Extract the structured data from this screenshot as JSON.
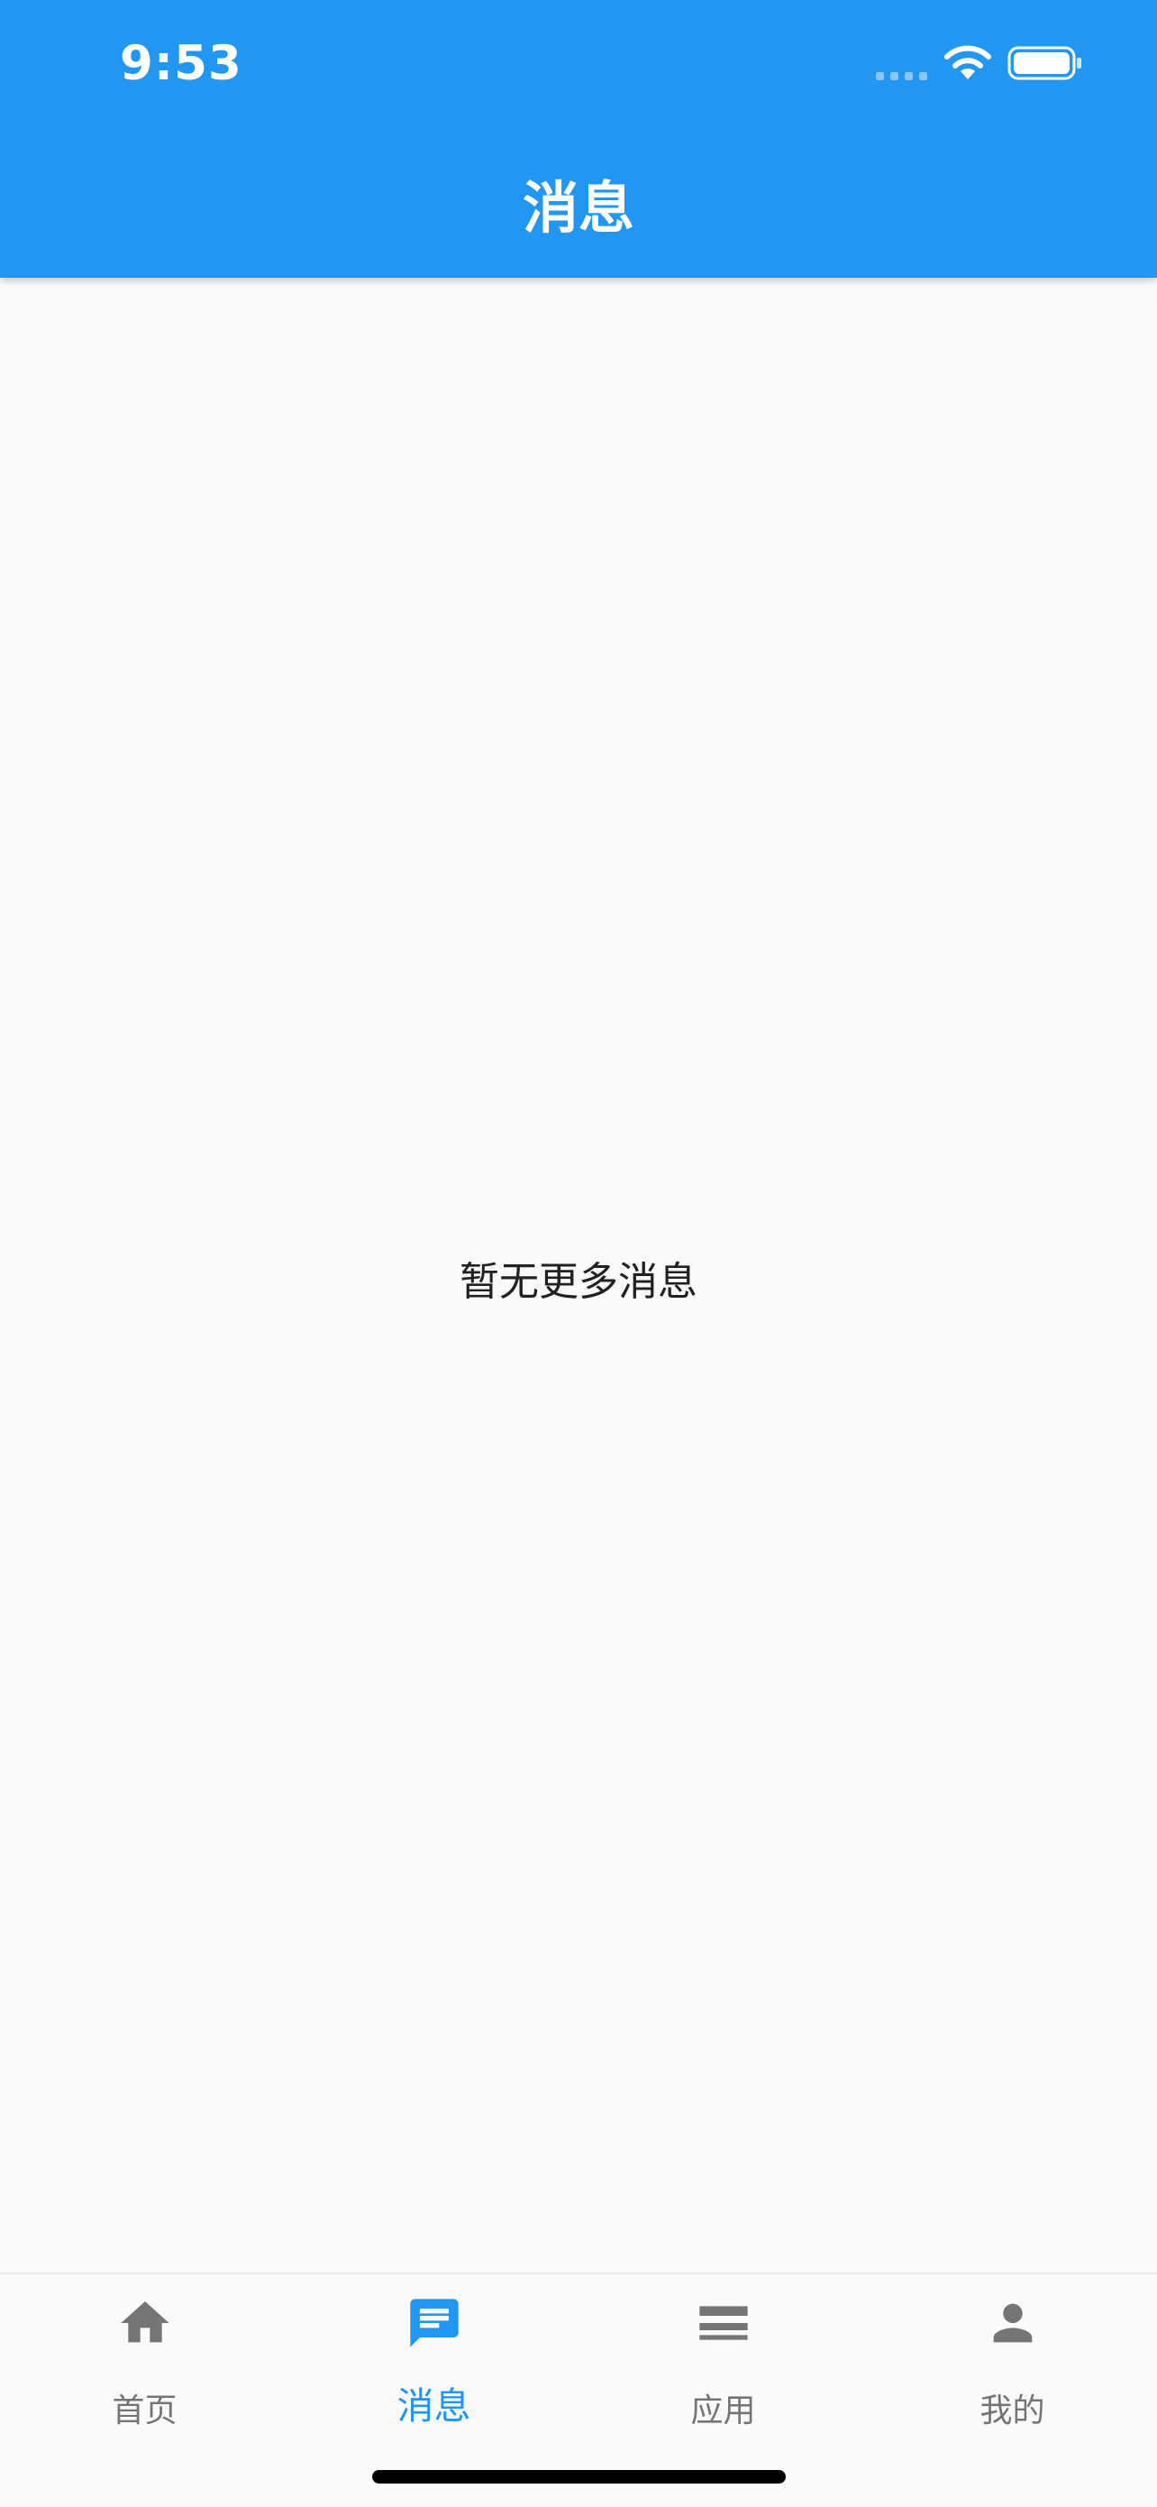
{
  "status_bar": {
    "time": "9:53",
    "wifi_icon": "wifi-icon",
    "battery_icon": "battery-icon"
  },
  "header": {
    "title": "消息"
  },
  "main": {
    "empty_message": "暂无更多消息"
  },
  "bottom_nav": {
    "items": [
      {
        "label": "首页",
        "icon": "home-icon",
        "active": false
      },
      {
        "label": "消息",
        "icon": "message-icon",
        "active": true
      },
      {
        "label": "应用",
        "icon": "apps-list-icon",
        "active": false
      },
      {
        "label": "我的",
        "icon": "person-icon",
        "active": false
      }
    ]
  },
  "colors": {
    "primary": "#2196f3",
    "inactive": "#757575",
    "background": "#fafafa",
    "text": "#212121"
  }
}
